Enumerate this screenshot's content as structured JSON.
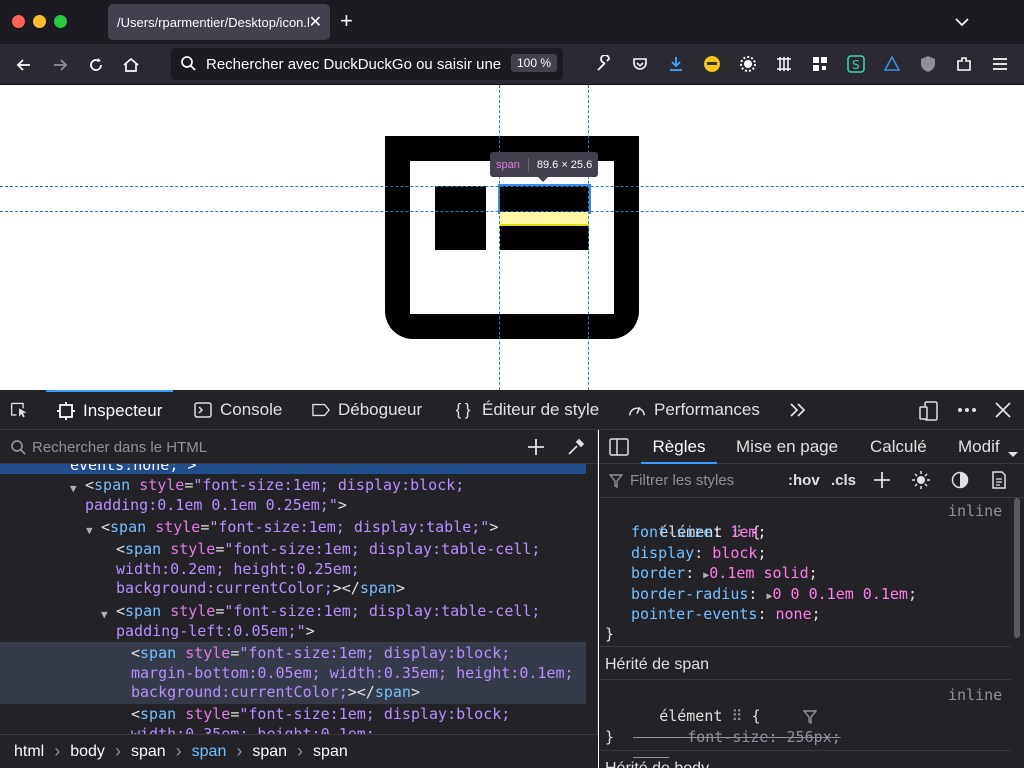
{
  "browser": {
    "tab_title": "/Users/rparmentier/Desktop/icon.html",
    "tab_close": "✕",
    "new_tab": "+",
    "url_placeholder": "Rechercher avec DuckDuckGo ou saisir une adresse",
    "zoom": "100 %"
  },
  "overlay": {
    "tooltip_tag": "span",
    "tooltip_size": "89.6 × 25.6"
  },
  "devtools": {
    "tabs": [
      "Inspecteur",
      "Console",
      "Débogueur",
      "Éditeur de style",
      "Performances"
    ],
    "search_placeholder": "Rechercher dans le HTML",
    "markup_top_fragment": "events:none;\">",
    "markup": [
      {
        "t": "<",
        "tag": "span",
        "a": "style",
        "v": "\"font-size:1em; display:block;"
      },
      {
        "cont": "padding:0.1em 0.1em 0.25em;\">"
      },
      {
        "t": "<",
        "tag": "span",
        "a": "style",
        "v": "\"font-size:1em; display:table;\">"
      },
      {
        "t": "<",
        "tag": "span",
        "a": "style",
        "v": "\"font-size:1em; display:table-cell;"
      },
      {
        "cont": "width:0.2em; height:0.25em;"
      },
      {
        "cont": "background:currentColor;\"></span>"
      },
      {
        "t": "<",
        "tag": "span",
        "a": "style",
        "v": "\"font-size:1em; display:table-cell;"
      },
      {
        "cont": "padding-left:0.05em;\">"
      },
      {
        "t": "<",
        "tag": "span",
        "a": "style",
        "v": "\"font-size:1em; display:block;"
      },
      {
        "cont": "margin-bottom:0.05em; width:0.35em; height:0.1em;"
      },
      {
        "cont": "background:currentColor;\"></span>"
      },
      {
        "t": "<",
        "tag": "span",
        "a": "style",
        "v": "\"font-size:1em; display:block;"
      },
      {
        "cont": "width:0.35em; height:0.1em;"
      }
    ],
    "breadcrumbs": [
      "html",
      "body",
      "span",
      "span",
      "span",
      "span"
    ],
    "rules_tabs": [
      "Règles",
      "Mise en page",
      "Calculé",
      "Modif"
    ],
    "filter_placeholder": "Filtrer les styles",
    "hov": ":hov",
    "cls": ".cls",
    "rule1": {
      "selector": "élément",
      "source": "inline",
      "props": [
        {
          "name": "font-size",
          "value": "1em"
        },
        {
          "name": "display",
          "value": "block"
        },
        {
          "name": "border",
          "value": "0.1em solid"
        },
        {
          "name": "border-radius",
          "value": "0 0 0.1em 0.1em"
        },
        {
          "name": "pointer-events",
          "value": "none"
        }
      ]
    },
    "inherited1": "Hérité de span",
    "rule2": {
      "selector": "élément",
      "source": "inline",
      "props": [
        {
          "name": "font-size",
          "value": "256px"
        }
      ]
    },
    "inherited2": "Hérité de body"
  },
  "colors": {
    "tab_bg": "#1c1b22",
    "nav_bg": "#2b2a33",
    "devtools_bg": "#232327",
    "accent": "#3a9bfe",
    "guide": "#2b7bb9"
  }
}
